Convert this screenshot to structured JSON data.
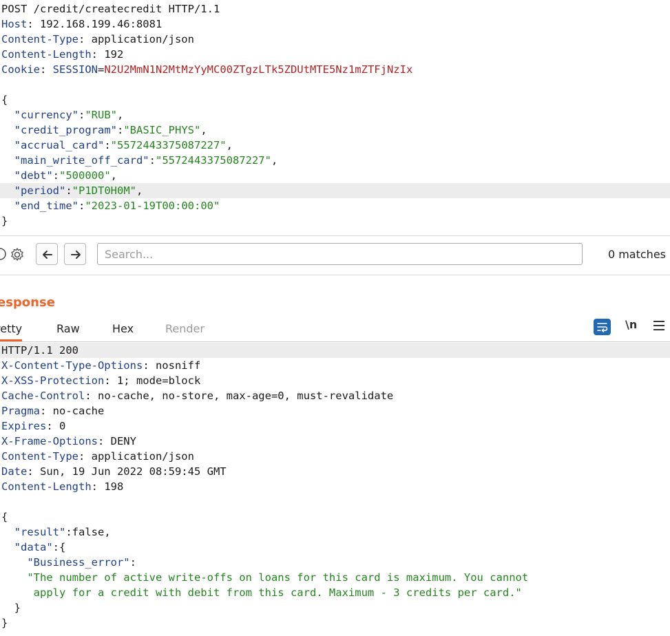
{
  "request": {
    "lines": [
      {
        "parts": [
          {
            "t": "POST /credit/createcredit HTTP/1.1",
            "c": ""
          }
        ]
      },
      {
        "parts": [
          {
            "t": "Host",
            "c": "key"
          },
          {
            "t": ": 192.168.199.46:8081",
            "c": ""
          }
        ]
      },
      {
        "parts": [
          {
            "t": "Content-Type",
            "c": "key"
          },
          {
            "t": ": application/json",
            "c": ""
          }
        ]
      },
      {
        "parts": [
          {
            "t": "Content-Length",
            "c": "key"
          },
          {
            "t": ": 192",
            "c": ""
          }
        ]
      },
      {
        "parts": [
          {
            "t": "Cookie",
            "c": "key"
          },
          {
            "t": ": ",
            "c": ""
          },
          {
            "t": "SESSION",
            "c": "sesk"
          },
          {
            "t": "=",
            "c": ""
          },
          {
            "t": "N2U2MmN1N2MtMzYyMC00ZTgzLTk5ZDUtMTE5Nz1mZTFjNzIx",
            "c": "ses"
          }
        ]
      },
      {
        "parts": [
          {
            "t": "",
            "c": ""
          }
        ]
      },
      {
        "parts": [
          {
            "t": "{",
            "c": ""
          }
        ]
      },
      {
        "parts": [
          {
            "t": "  ",
            "c": ""
          },
          {
            "t": "\"currency\"",
            "c": "key"
          },
          {
            "t": ":",
            "c": ""
          },
          {
            "t": "\"RUB\"",
            "c": "str"
          },
          {
            "t": ",",
            "c": ""
          }
        ]
      },
      {
        "parts": [
          {
            "t": "  ",
            "c": ""
          },
          {
            "t": "\"credit_program\"",
            "c": "key"
          },
          {
            "t": ":",
            "c": ""
          },
          {
            "t": "\"BASIC_PHYS\"",
            "c": "str"
          },
          {
            "t": ",",
            "c": ""
          }
        ]
      },
      {
        "parts": [
          {
            "t": "  ",
            "c": ""
          },
          {
            "t": "\"accrual_card\"",
            "c": "key"
          },
          {
            "t": ":",
            "c": ""
          },
          {
            "t": "\"5572443375087227\"",
            "c": "str"
          },
          {
            "t": ",",
            "c": ""
          }
        ]
      },
      {
        "parts": [
          {
            "t": "  ",
            "c": ""
          },
          {
            "t": "\"main_write_off_card\"",
            "c": "key"
          },
          {
            "t": ":",
            "c": ""
          },
          {
            "t": "\"5572443375087227\"",
            "c": "str"
          },
          {
            "t": ",",
            "c": ""
          }
        ]
      },
      {
        "parts": [
          {
            "t": "  ",
            "c": ""
          },
          {
            "t": "\"debt\"",
            "c": "key"
          },
          {
            "t": ":",
            "c": ""
          },
          {
            "t": "\"500000\"",
            "c": "str"
          },
          {
            "t": ",",
            "c": ""
          }
        ]
      },
      {
        "parts": [
          {
            "t": "  ",
            "c": ""
          },
          {
            "t": "\"period\"",
            "c": "key"
          },
          {
            "t": ":",
            "c": ""
          },
          {
            "t": "\"P1DT0H0M\"",
            "c": "str"
          },
          {
            "t": ",",
            "c": ""
          }
        ],
        "highlight": true
      },
      {
        "parts": [
          {
            "t": "  ",
            "c": ""
          },
          {
            "t": "\"end_time\"",
            "c": "key"
          },
          {
            "t": ":",
            "c": ""
          },
          {
            "t": "\"2023-01-19T00:00:00\"",
            "c": "str"
          }
        ]
      },
      {
        "parts": [
          {
            "t": "}",
            "c": ""
          }
        ]
      }
    ]
  },
  "search": {
    "placeholder": "Search...",
    "matches": "0 matches"
  },
  "response": {
    "title": "esponse",
    "tabs": [
      {
        "label": "retty",
        "active": true
      },
      {
        "label": "Raw"
      },
      {
        "label": "Hex"
      },
      {
        "label": "Render",
        "disabled": true
      }
    ],
    "newline_label": "\\n",
    "lines": [
      {
        "parts": [
          {
            "t": "HTTP/1.1 200",
            "c": ""
          }
        ],
        "highlight": true
      },
      {
        "parts": [
          {
            "t": "X-Content-Type-Options",
            "c": "key"
          },
          {
            "t": ": nosniff",
            "c": ""
          }
        ]
      },
      {
        "parts": [
          {
            "t": "X-XSS-Protection",
            "c": "key"
          },
          {
            "t": ": 1; mode=block",
            "c": ""
          }
        ]
      },
      {
        "parts": [
          {
            "t": "Cache-Control",
            "c": "key"
          },
          {
            "t": ": no-cache, no-store, max-age=0, must-revalidate",
            "c": ""
          }
        ]
      },
      {
        "parts": [
          {
            "t": "Pragma",
            "c": "key"
          },
          {
            "t": ": no-cache",
            "c": ""
          }
        ]
      },
      {
        "parts": [
          {
            "t": "Expires",
            "c": "key"
          },
          {
            "t": ": 0",
            "c": ""
          }
        ]
      },
      {
        "parts": [
          {
            "t": "X-Frame-Options",
            "c": "key"
          },
          {
            "t": ": DENY",
            "c": ""
          }
        ]
      },
      {
        "parts": [
          {
            "t": "Content-Type",
            "c": "key"
          },
          {
            "t": ": application/json",
            "c": ""
          }
        ]
      },
      {
        "parts": [
          {
            "t": "Date",
            "c": "key"
          },
          {
            "t": ": Sun, 19 Jun 2022 08:59:45 GMT",
            "c": ""
          }
        ]
      },
      {
        "parts": [
          {
            "t": "Content-Length",
            "c": "key"
          },
          {
            "t": ": 198",
            "c": ""
          }
        ]
      },
      {
        "parts": [
          {
            "t": "",
            "c": ""
          }
        ]
      },
      {
        "parts": [
          {
            "t": "{",
            "c": ""
          }
        ]
      },
      {
        "parts": [
          {
            "t": "  ",
            "c": ""
          },
          {
            "t": "\"result\"",
            "c": "key"
          },
          {
            "t": ":false,",
            "c": ""
          }
        ]
      },
      {
        "parts": [
          {
            "t": "  ",
            "c": ""
          },
          {
            "t": "\"data\"",
            "c": "key"
          },
          {
            "t": ":{",
            "c": ""
          }
        ]
      },
      {
        "parts": [
          {
            "t": "    ",
            "c": ""
          },
          {
            "t": "\"Business_error\"",
            "c": "key"
          },
          {
            "t": ":",
            "c": ""
          }
        ]
      },
      {
        "parts": [
          {
            "t": "    ",
            "c": ""
          },
          {
            "t": "\"The number of active write-offs on loans for this card is maximum. You cannot",
            "c": "str"
          }
        ]
      },
      {
        "parts": [
          {
            "t": "     ",
            "c": ""
          },
          {
            "t": "apply for a credit with debit from this card. Maximum - 3 credits per card.\"",
            "c": "str"
          }
        ]
      },
      {
        "parts": [
          {
            "t": "  }",
            "c": ""
          }
        ]
      },
      {
        "parts": [
          {
            "t": "}",
            "c": ""
          }
        ]
      }
    ]
  }
}
